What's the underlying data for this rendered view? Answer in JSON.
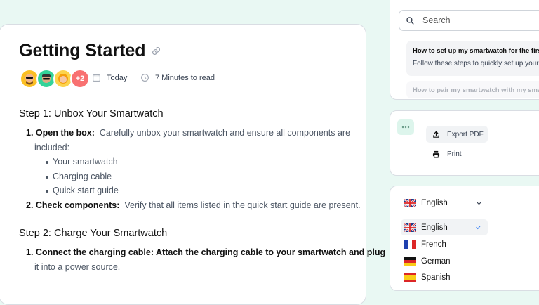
{
  "article": {
    "title": "Getting Started",
    "avatars": [
      "avatar-1",
      "avatar-2",
      "avatar-3"
    ],
    "more_count": "+2",
    "date": "Today",
    "read_time": "7 Minutes to read",
    "step1_heading": "Step 1: Unbox Your Smartwatch",
    "step1_item1_label": "1. Open the box:",
    "step1_item1_text": "Carefully unbox your smartwatch and ensure all components are",
    "step1_item1_cont": "included:",
    "bullets": [
      "Your smartwatch",
      "Charging cable",
      "Quick start guide"
    ],
    "step1_item2_label": "2. Check components:",
    "step1_item2_text": "Verify that all items listed in the quick start guide are present.",
    "step2_heading": "Step 2: Charge Your Smartwatch",
    "step2_item1_label": "1. Connect the charging cable: Attach the charging cable to your smartwatch and plug",
    "step2_item1_cont": "it into a power source."
  },
  "search": {
    "placeholder": "Search",
    "results": [
      {
        "title": "How to set up my smartwatch for the firs",
        "desc": "Follow these steps to quickly set up your"
      },
      {
        "title": "How to pair my smartwatch with my sma"
      }
    ]
  },
  "export_menu": {
    "export_pdf": "Export PDF",
    "print": "Print"
  },
  "language": {
    "current": "English",
    "options": [
      "English",
      "French",
      "German",
      "Spanish"
    ]
  },
  "colors": {
    "background": "#e9f8f3",
    "accent_badge": "#f87171",
    "check": "#3b82f6"
  }
}
